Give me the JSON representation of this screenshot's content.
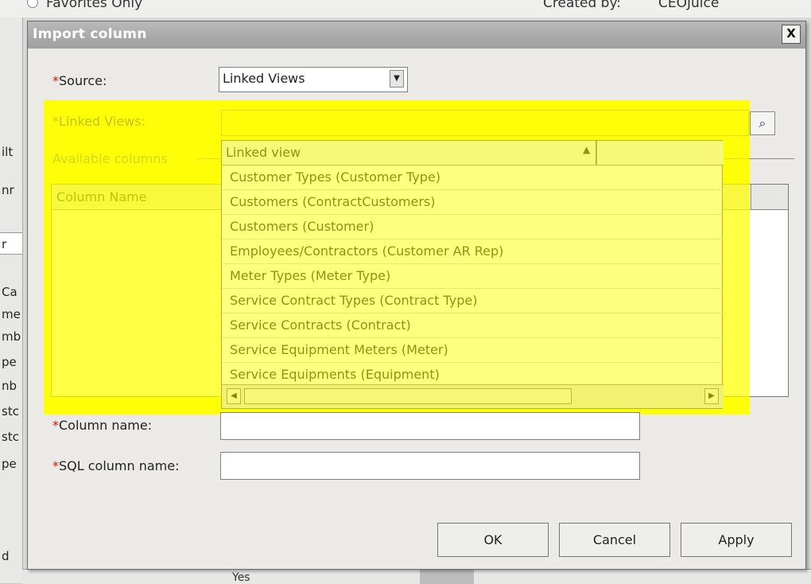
{
  "background": {
    "favorites_label": "Favorites Only",
    "created_by_label": "Created by:",
    "created_by_value": "CEOJuice",
    "left_fragments": [
      "ilt",
      "nr",
      "r",
      "Ca",
      "me",
      "mb",
      "pe",
      "nb",
      "stc",
      "stc",
      "pe",
      "d"
    ],
    "bottom_value": "Yes"
  },
  "dialog": {
    "title": "Import column",
    "close_label": "X",
    "source_label": "Source:",
    "source_value": "Linked Views",
    "linked_views_label": "Linked Views:",
    "available_columns_label": "Available columns",
    "column_grid_header": "Column Name",
    "column_name_label": "Column name:",
    "sql_column_name_label": "SQL column name:",
    "required_marker": "*",
    "buttons": {
      "ok": "OK",
      "cancel": "Cancel",
      "apply": "Apply"
    }
  },
  "dropdown": {
    "header": "Linked view",
    "items": [
      "Customer Types (Customer Type)",
      "Customers (ContractCustomers)",
      "Customers (Customer)",
      "Employees/Contractors (Customer AR Rep)",
      "Meter Types (Meter Type)",
      "Service Contract Types (Contract Type)",
      "Service Contracts (Contract)",
      "Service Equipment Meters (Meter)",
      "Service Equipments (Equipment)"
    ]
  },
  "colors": {
    "highlight": "#ffff00",
    "required": "#dd1111",
    "titlebar": "#a8a8a8"
  }
}
